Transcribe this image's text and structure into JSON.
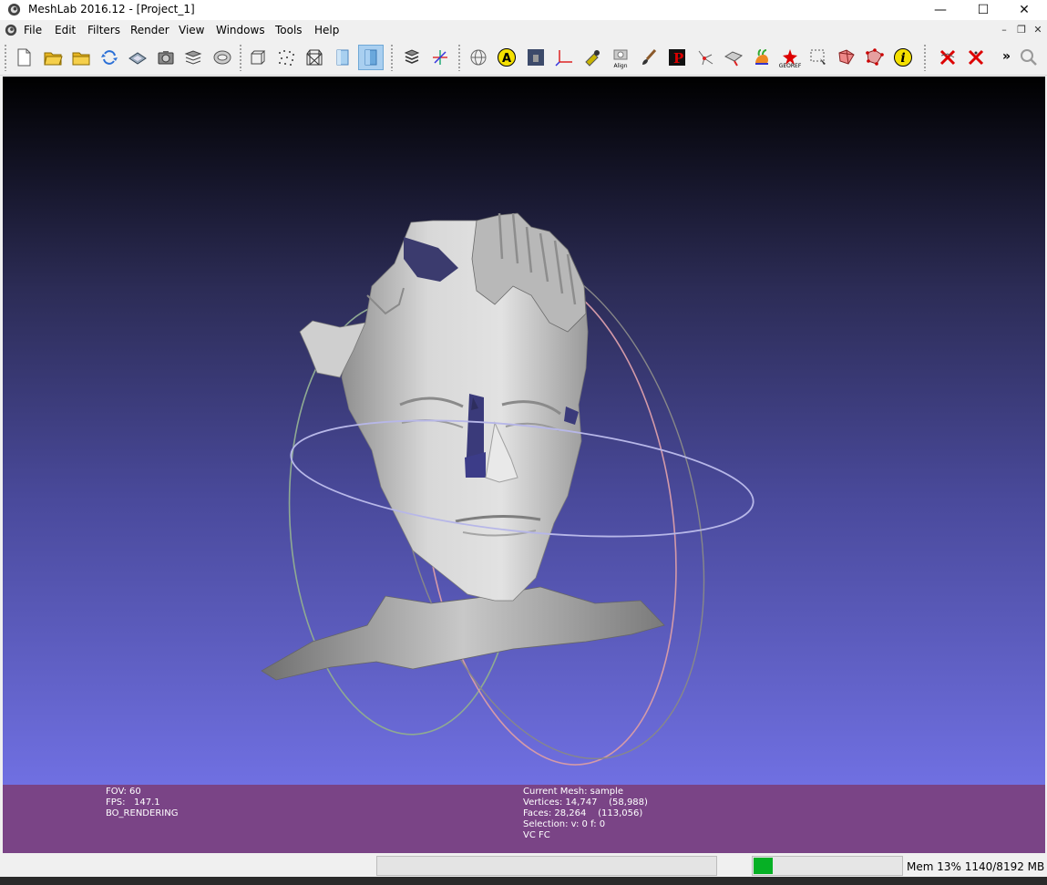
{
  "window": {
    "title": "MeshLab 2016.12 - [Project_1]",
    "minimize": "—",
    "maximize": "☐",
    "close": "✕"
  },
  "menubar": {
    "items": [
      "File",
      "Edit",
      "Filters",
      "Render",
      "View",
      "Windows",
      "Tools",
      "Help"
    ],
    "mdi_minimize": "–",
    "mdi_restore": "❐",
    "mdi_close": "✕"
  },
  "toolbar": {
    "groups": [
      [
        "new-project",
        "open-project",
        "open-mesh",
        "reload",
        "export-mesh",
        "snapshot",
        "layers",
        "raster-layer"
      ],
      [
        "render-bbox",
        "render-points",
        "render-wireframe",
        "render-flat",
        "render-smooth"
      ],
      [
        "layer-stack",
        "axis-tool"
      ],
      [
        "select-tool",
        "annotate",
        "texture-paint",
        "measure",
        "pick-points",
        "manipulator",
        "z-painting",
        "mesh-paint",
        "select-connected",
        "align",
        "select-faces",
        "select-vertices",
        "georef",
        "select-rect",
        "select-face-rect",
        "select-vertex-rect",
        "info"
      ],
      [
        "delete-selected-faces",
        "delete-selected-verts"
      ]
    ],
    "overflow": "»",
    "labels": {
      "align": "Align",
      "georef": "GEOREF"
    }
  },
  "viewport": {
    "bg_top": "#000000",
    "bg_bottom": "#7070e2",
    "mesh_name": "sample"
  },
  "info_overlay": {
    "left": [
      "FOV: 60",
      "FPS:   147.1",
      "BO_RENDERING"
    ],
    "right": [
      "Current Mesh: sample",
      "Vertices: 14,747    (58,988)",
      "Faces: 28,264    (113,056)",
      "Selection: v: 0 f: 0",
      "VC FC"
    ]
  },
  "statusbar": {
    "memory_text": "Mem 13% 1140/8192 MB",
    "memory_usage": 0.13
  }
}
